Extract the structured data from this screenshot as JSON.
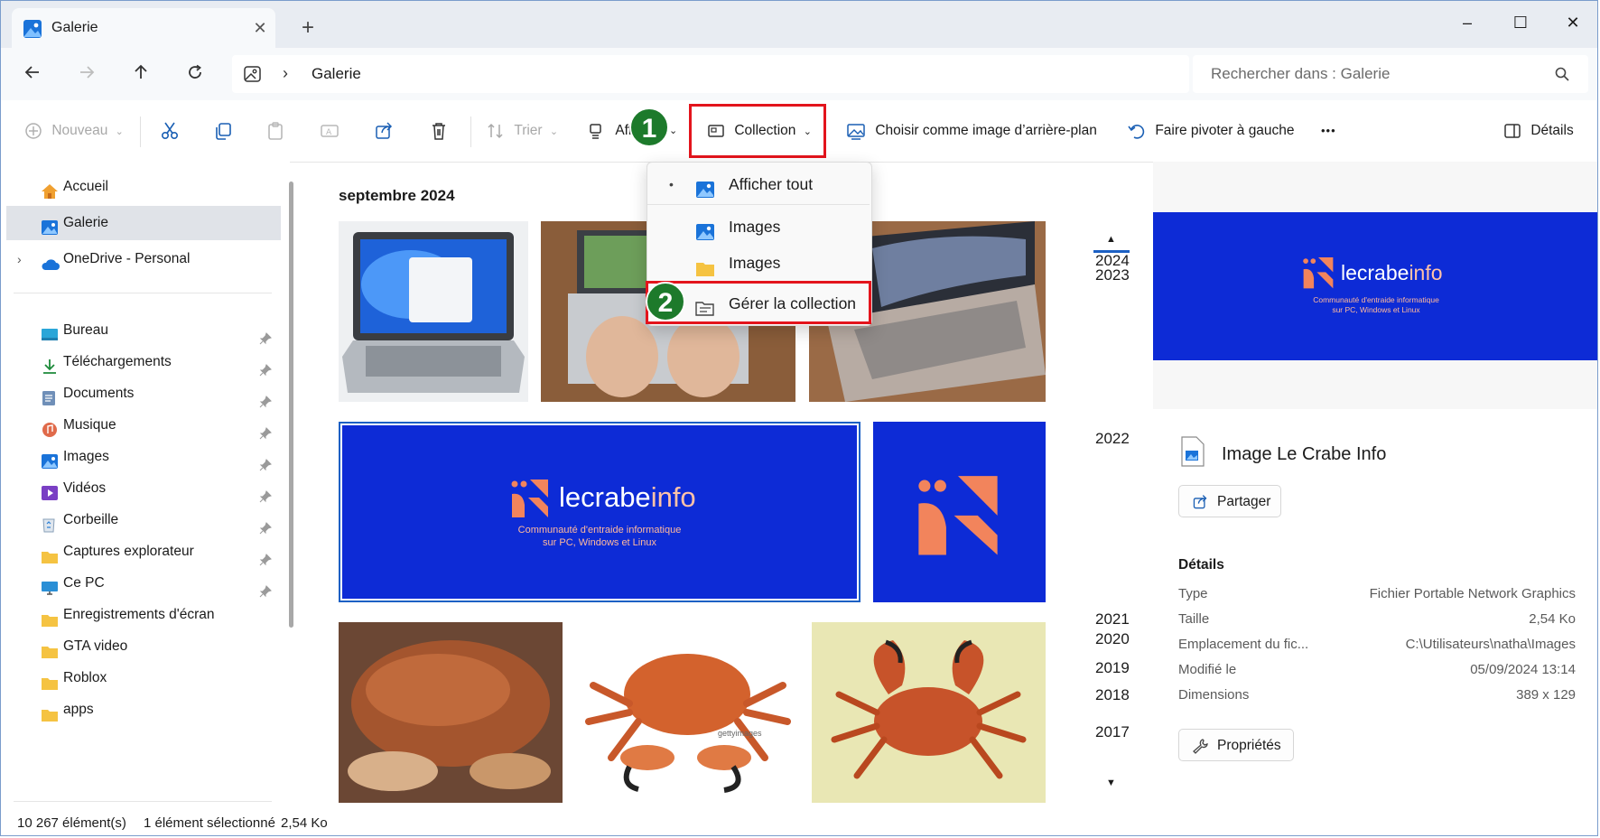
{
  "window": {
    "tab_title": "Galerie",
    "new_tab_label": "+",
    "minimize": "–",
    "maximize": "☐",
    "close": "✕"
  },
  "address": {
    "back_icon": "back-arrow-icon",
    "forward_icon": "forward-arrow-icon",
    "up_icon": "up-arrow-icon",
    "refresh_icon": "refresh-icon",
    "chevron": "›",
    "path": "Galerie",
    "search_placeholder": "Rechercher dans : Galerie"
  },
  "toolbar": {
    "new_label": "Nouveau",
    "sort_label": "Trier",
    "view_label": "Affi",
    "collection_label": "Collection",
    "set_background_label": "Choisir comme image d’arrière-plan",
    "rotate_left_label": "Faire pivoter à gauche",
    "more_label": "•••",
    "details_label": "Détails",
    "badge_1": "1",
    "badge_2": "2"
  },
  "collection_menu": {
    "items": [
      {
        "label": "Afficher tout",
        "icon": "gallery-icon",
        "selected": true
      },
      {
        "label": "Images",
        "icon": "images-icon",
        "selected": false
      },
      {
        "label": "Images",
        "icon": "folder-icon",
        "selected": false
      },
      {
        "label": "Gérer la collection",
        "icon": "manage-collection-icon",
        "selected": false
      }
    ],
    "selected_marker": "•"
  },
  "nav": {
    "items": [
      {
        "label": "Accueil",
        "icon": "home-icon",
        "pinned": false
      },
      {
        "label": "Galerie",
        "icon": "gallery-icon",
        "pinned": false,
        "selected": true
      },
      {
        "label": "OneDrive - Personal",
        "icon": "cloud-icon",
        "pinned": false
      },
      {
        "label": "Bureau",
        "icon": "desktop-icon",
        "pinned": true
      },
      {
        "label": "Téléchargements",
        "icon": "download-icon",
        "pinned": true
      },
      {
        "label": "Documents",
        "icon": "documents-icon",
        "pinned": true
      },
      {
        "label": "Musique",
        "icon": "music-icon",
        "pinned": true
      },
      {
        "label": "Images",
        "icon": "pictures-icon",
        "pinned": true
      },
      {
        "label": "Vidéos",
        "icon": "videos-icon",
        "pinned": true
      },
      {
        "label": "Corbeille",
        "icon": "recycle-bin-icon",
        "pinned": true
      },
      {
        "label": "Captures explorateur",
        "icon": "folder-icon",
        "pinned": true
      },
      {
        "label": "Ce PC",
        "icon": "computer-icon",
        "pinned": true
      },
      {
        "label": "Enregistrements d'écran",
        "icon": "folder-icon",
        "pinned": false
      },
      {
        "label": "GTA video",
        "icon": "folder-icon",
        "pinned": false
      },
      {
        "label": "Roblox",
        "icon": "folder-icon",
        "pinned": false
      },
      {
        "label": "apps",
        "icon": "folder-icon",
        "pinned": false
      }
    ]
  },
  "gallery": {
    "month_header": "septembre 2024",
    "logo_text_a": "lecrabe",
    "logo_text_b": "info",
    "logo_sub_1": "Communauté d'entraide informatique",
    "logo_sub_2": "sur PC, Windows et Linux",
    "watermark": "gettyimages"
  },
  "timeline": {
    "years": [
      "2024",
      "2023",
      "2022",
      "2021",
      "2020",
      "2019",
      "2018",
      "2017"
    ],
    "up_arrow": "▲",
    "down_arrow": "▼"
  },
  "details_pane": {
    "file_title": "Image Le Crabe Info",
    "share_label": "Partager",
    "section_label": "Détails",
    "rows": [
      {
        "key": "Type",
        "value": "Fichier Portable Network Graphics"
      },
      {
        "key": "Taille",
        "value": "2,54 Ko"
      },
      {
        "key": "Emplacement du fic...",
        "value": "C:\\Utilisateurs\\natha\\Images"
      },
      {
        "key": "Modifié le",
        "value": "05/09/2024 13:14"
      },
      {
        "key": "Dimensions",
        "value": "389 x 129"
      }
    ],
    "properties_label": "Propriétés"
  },
  "status": {
    "count": "10 267 élément(s)",
    "selection": "1 élément sélectionné",
    "size": "2,54 Ko"
  },
  "colors": {
    "accent": "#0d2bd6",
    "logo_orange": "#f2845c",
    "badge_green": "#1d7a2b",
    "highlight_red": "#e3141c"
  }
}
